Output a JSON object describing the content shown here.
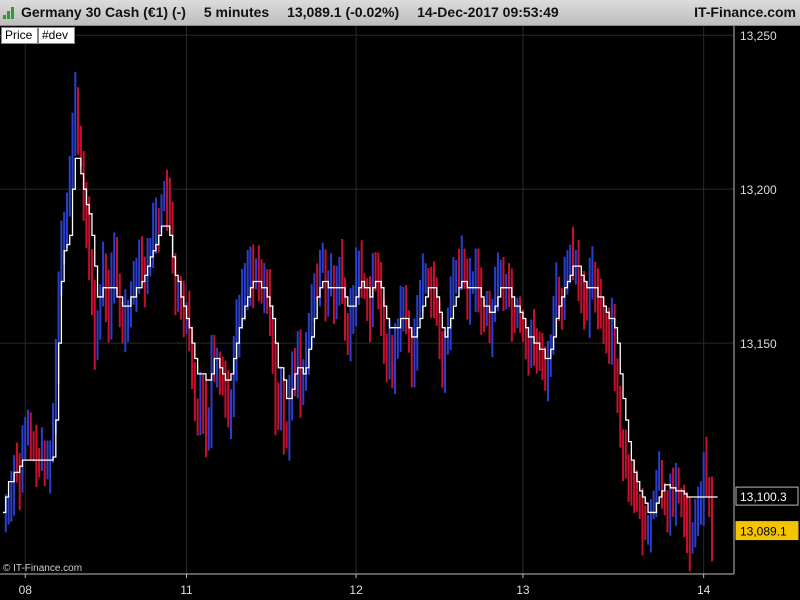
{
  "header": {
    "instrument": "Germany 30 Cash (€1) (-)",
    "interval": "5 minutes",
    "last_quote": "13,089.1 (-0.02%)",
    "datetime": "14-Dec-2017 09:53:49",
    "site": "IT-Finance.com"
  },
  "tabs": [
    {
      "label": "Price"
    },
    {
      "label": "#dev"
    }
  ],
  "copyright": "© IT-Finance.com",
  "colors": {
    "background": "#000000",
    "grid": "#2a2a2a",
    "candle_up": "#2b3fcf",
    "candle_down": "#c8102e",
    "step_line": "#ffffff",
    "price_flag": "#f5c400"
  },
  "chart_data": {
    "type": "line",
    "ylim": [
      13075,
      13253
    ],
    "y_ticks": [
      {
        "value": 13250,
        "label": "13,250"
      },
      {
        "value": 13200,
        "label": "13,200"
      },
      {
        "value": 13150,
        "label": "13,150"
      }
    ],
    "x_ticks": [
      {
        "index": 8,
        "label": "08"
      },
      {
        "index": 66,
        "label": "11"
      },
      {
        "index": 127,
        "label": "12"
      },
      {
        "index": 187,
        "label": "13"
      },
      {
        "index": 252,
        "label": "14"
      }
    ],
    "grid": true,
    "series": [
      {
        "values": [
          13095,
          13095,
          13098,
          13103,
          13111,
          13110,
          13104,
          13116,
          13120,
          13121,
          13118,
          13114,
          13113,
          13112,
          13113,
          13110,
          13111,
          13115,
          13125,
          13145,
          13170,
          13185,
          13190,
          13195,
          13205,
          13218,
          13230,
          13215,
          13210,
          13195,
          13188,
          13175,
          13165,
          13150,
          13155,
          13165,
          13175,
          13165,
          13160,
          13170,
          13178,
          13168,
          13160,
          13155,
          13160,
          13160,
          13168,
          13170,
          13175,
          13178,
          13175,
          13170,
          13175,
          13182,
          13188,
          13190,
          13188,
          13195,
          13200,
          13195,
          13190,
          13175,
          13165,
          13168,
          13162,
          13155,
          13160,
          13150,
          13138,
          13130,
          13128,
          13135,
          13130,
          13120,
          13125,
          13150,
          13140,
          13145,
          13140,
          13138,
          13135,
          13128,
          13132,
          13145,
          13155,
          13160,
          13165,
          13170,
          13172,
          13175,
          13170,
          13172,
          13170,
          13168,
          13168,
          13165,
          13160,
          13145,
          13130,
          13125,
          13135,
          13120,
          13118,
          13130,
          13145,
          13140,
          13150,
          13135,
          13138,
          13145,
          13155,
          13160,
          13170,
          13168,
          13175,
          13178,
          13165,
          13168,
          13170,
          13160,
          13170,
          13175,
          13165,
          13155,
          13150,
          13160,
          13165,
          13172,
          13175,
          13170,
          13168,
          13165,
          13160,
          13175,
          13170,
          13168,
          13160,
          13150,
          13145,
          13148,
          13140,
          13150,
          13155,
          13160,
          13162,
          13158,
          13150,
          13145,
          13150,
          13160,
          13165,
          13170,
          13172,
          13170,
          13168,
          13165,
          13158,
          13148,
          13140,
          13150,
          13155,
          13165,
          13172,
          13175,
          13170,
          13178,
          13172,
          13165,
          13168,
          13170,
          13172,
          13168,
          13162,
          13158,
          13160,
          13155,
          13160,
          13168,
          13172,
          13175,
          13165,
          13170,
          13168,
          13160,
          13158,
          13162,
          13158,
          13155,
          13150,
          13148,
          13152,
          13150,
          13148,
          13145,
          13142,
          13140,
          13145,
          13150,
          13160,
          13168,
          13165,
          13160,
          13170,
          13175,
          13180,
          13175,
          13178,
          13170,
          13168,
          13162,
          13160,
          13168,
          13172,
          13165,
          13162,
          13160,
          13158,
          13155,
          13150,
          13160,
          13140,
          13130,
          13120,
          13115,
          13110,
          13108,
          13105,
          13100,
          13098,
          13095,
          13090,
          13088,
          13092,
          13095,
          13100,
          13105,
          13108,
          13102,
          13100,
          13095,
          13100,
          13098,
          13102,
          13100,
          13098,
          13095,
          13090,
          13085,
          13088,
          13092,
          13095,
          13100,
          13110,
          13102,
          13098,
          13089
        ]
      },
      {
        "values": [
          13095,
          13100,
          13105,
          13105,
          13108,
          13108,
          13110,
          13112,
          13112,
          13112,
          13112,
          13112,
          13112,
          13112,
          13112,
          13112,
          13112,
          13112,
          13113,
          13125,
          13150,
          13170,
          13180,
          13182,
          13185,
          13200,
          13210,
          13210,
          13205,
          13200,
          13195,
          13192,
          13185,
          13175,
          13165,
          13165,
          13168,
          13168,
          13168,
          13168,
          13168,
          13165,
          13165,
          13162,
          13162,
          13162,
          13165,
          13165,
          13168,
          13168,
          13170,
          13172,
          13175,
          13178,
          13180,
          13182,
          13185,
          13188,
          13188,
          13188,
          13185,
          13178,
          13172,
          13170,
          13165,
          13162,
          13158,
          13155,
          13150,
          13145,
          13140,
          13140,
          13140,
          13138,
          13138,
          13140,
          13145,
          13145,
          13142,
          13140,
          13138,
          13138,
          13140,
          13145,
          13150,
          13155,
          13158,
          13162,
          13165,
          13168,
          13170,
          13170,
          13170,
          13168,
          13168,
          13165,
          13162,
          13158,
          13150,
          13142,
          13142,
          13138,
          13132,
          13132,
          13135,
          13140,
          13142,
          13142,
          13140,
          13142,
          13148,
          13152,
          13158,
          13165,
          13168,
          13170,
          13170,
          13168,
          13168,
          13168,
          13168,
          13168,
          13168,
          13165,
          13162,
          13162,
          13162,
          13165,
          13168,
          13170,
          13168,
          13168,
          13165,
          13168,
          13170,
          13170,
          13168,
          13162,
          13158,
          13155,
          13155,
          13155,
          13155,
          13158,
          13158,
          13158,
          13155,
          13152,
          13152,
          13155,
          13158,
          13162,
          13165,
          13168,
          13168,
          13168,
          13165,
          13160,
          13155,
          13152,
          13155,
          13158,
          13162,
          13165,
          13168,
          13170,
          13170,
          13168,
          13168,
          13168,
          13168,
          13168,
          13165,
          13162,
          13162,
          13160,
          13160,
          13162,
          13165,
          13168,
          13168,
          13168,
          13168,
          13165,
          13162,
          13162,
          13160,
          13158,
          13155,
          13152,
          13152,
          13150,
          13150,
          13148,
          13148,
          13145,
          13145,
          13148,
          13152,
          13158,
          13162,
          13165,
          13168,
          13170,
          13172,
          13175,
          13175,
          13175,
          13172,
          13170,
          13168,
          13168,
          13168,
          13168,
          13165,
          13165,
          13162,
          13160,
          13158,
          13158,
          13155,
          13150,
          13140,
          13132,
          13125,
          13118,
          13112,
          13108,
          13105,
          13102,
          13100,
          13098,
          13095,
          13095,
          13095,
          13098,
          13100,
          13102,
          13104,
          13104,
          13103,
          13103,
          13102,
          13102,
          13102,
          13101,
          13100,
          13100,
          13100,
          13100,
          13100,
          13100,
          13100,
          13100,
          13100,
          13100,
          13100,
          13100
        ]
      }
    ],
    "markers": [
      {
        "value": 13100.3,
        "label": "13,100.3"
      },
      {
        "value": 13089.1,
        "label": "13,089.1"
      }
    ]
  }
}
